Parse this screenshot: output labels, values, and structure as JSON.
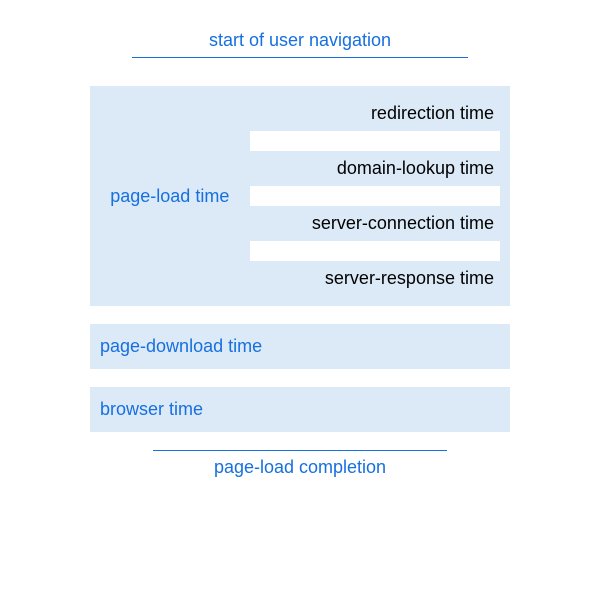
{
  "header": "start of user navigation",
  "footer": "page-load completion",
  "page_load": {
    "label": "page-load time",
    "phases": [
      "redirection time",
      "domain-lookup time",
      "server-connection time",
      "server-response time"
    ]
  },
  "page_download": "page-download time",
  "browser": "browser time"
}
